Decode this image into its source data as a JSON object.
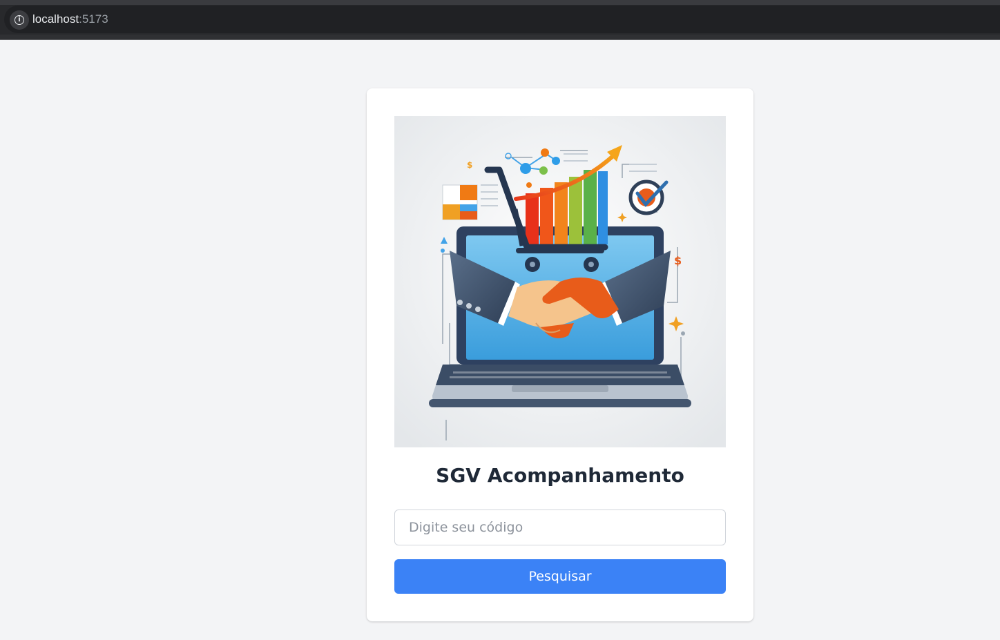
{
  "browser": {
    "url_host": "localhost",
    "url_port": ":5173",
    "info_icon": "info-icon"
  },
  "card": {
    "image_icon": "ecommerce-handshake-illustration",
    "title": "SGV Acompanhamento",
    "code_input": {
      "value": "",
      "placeholder": "Digite seu código"
    },
    "search_label": "Pesquisar"
  },
  "colors": {
    "page_background": "#f3f4f6",
    "card_background": "#ffffff",
    "title_text": "#1f2937",
    "button_primary": "#3b82f6",
    "button_text": "#ffffff"
  }
}
